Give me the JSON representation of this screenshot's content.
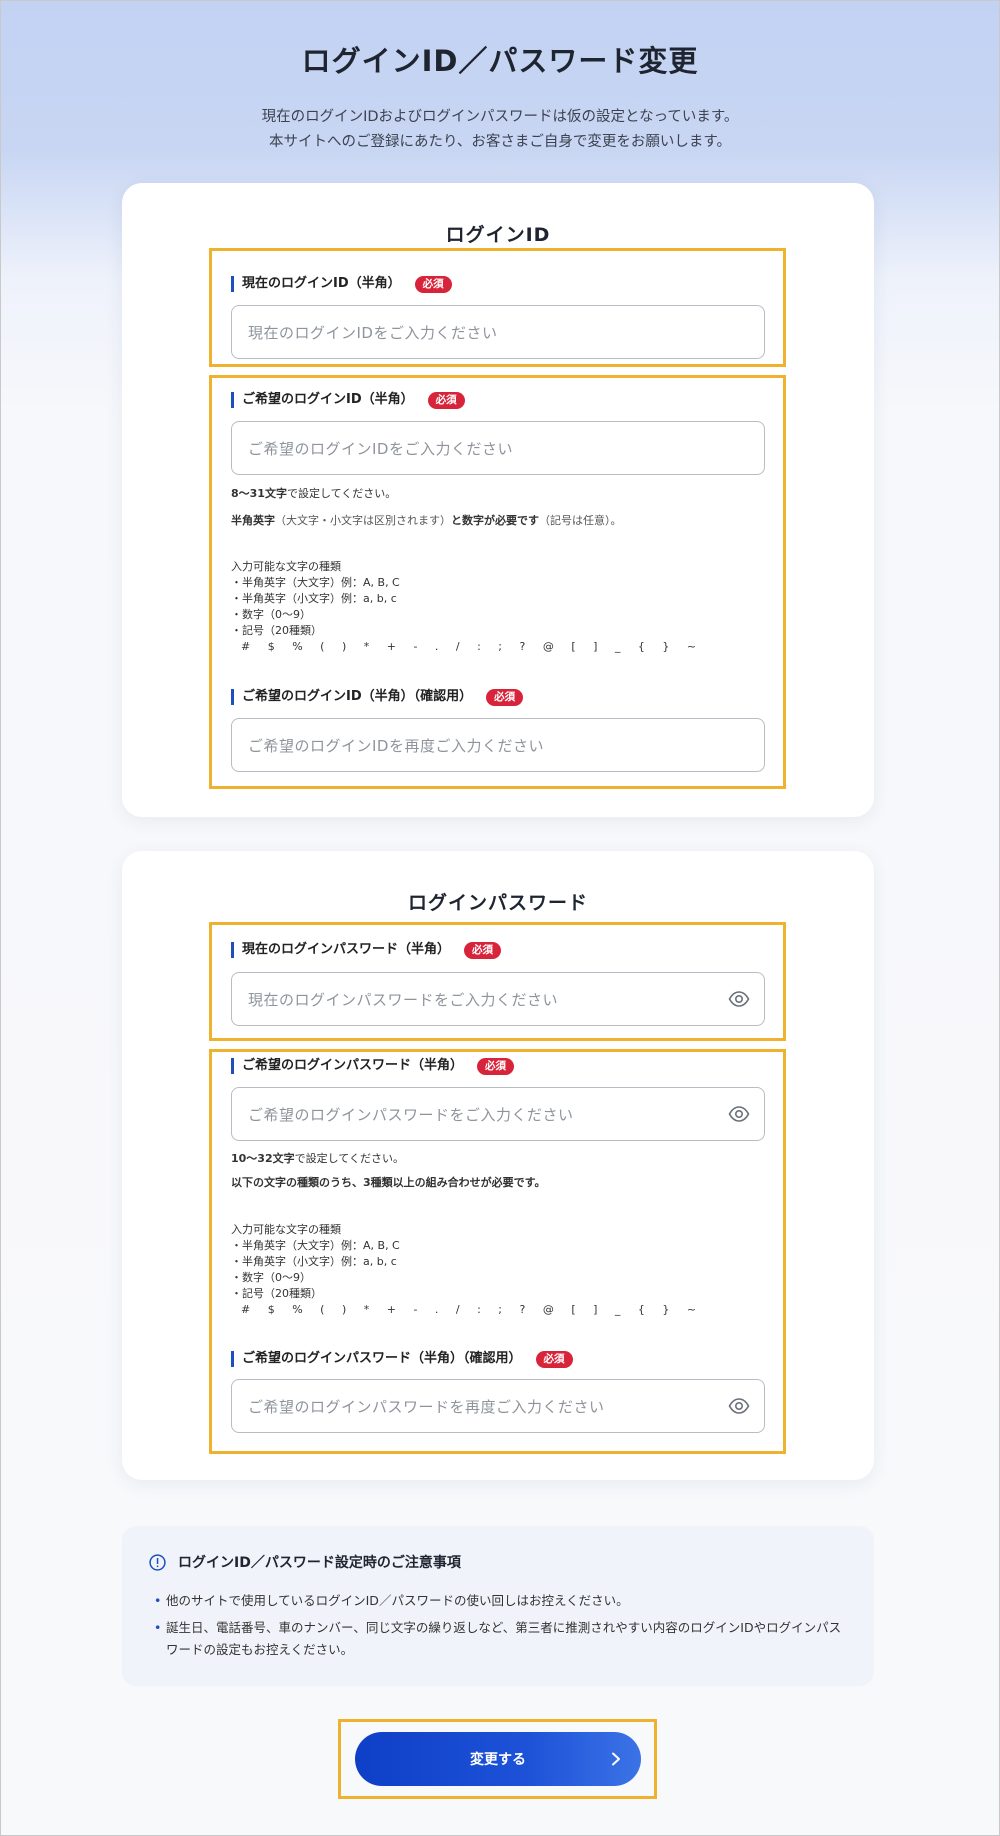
{
  "page": {
    "title": "ログインID／パスワード変更",
    "lead_line1": "現在のログインIDおよびログインパスワードは仮の設定となっています。",
    "lead_line2": "本サイトへのご登録にあたり、お客さまご自身で変更をお願いします。"
  },
  "required_label": "必須",
  "login_id": {
    "title": "ログインID",
    "current": {
      "label": "現在のログインID（半角）",
      "placeholder": "現在のログインIDをご入力ください"
    },
    "new": {
      "label": "ご希望のログインID（半角）",
      "placeholder": "ご希望のログインIDをご入力ください",
      "rule_length_bold": "8〜31文字",
      "rule_length_rest": "で設定してください。",
      "rule_mix_a": "半角英字",
      "rule_mix_b": "（大文字・小文字は区別されます）",
      "rule_mix_c": "と数字が必要です",
      "rule_mix_d": "（記号は任意）。",
      "chars_heading": "入力可能な文字の種類",
      "chars": [
        "・半角英字（大文字）例：A, B, C",
        "・半角英字（小文字）例：a, b, c",
        "・数字（0〜9）",
        "・記号（20種類）"
      ],
      "symbols": "# $ % ( ) * + - . / : ; ? @ [ ] _ { } ~"
    },
    "confirm": {
      "label": "ご希望のログインID（半角）（確認用）",
      "placeholder": "ご希望のログインIDを再度ご入力ください"
    }
  },
  "password": {
    "title": "ログインパスワード",
    "current": {
      "label": "現在のログインパスワード（半角）",
      "placeholder": "現在のログインパスワードをご入力ください"
    },
    "new": {
      "label": "ご希望のログインパスワード（半角）",
      "placeholder": "ご希望のログインパスワードをご入力ください",
      "rule_length_bold": "10〜32文字",
      "rule_length_rest": "で設定してください。",
      "rule_mix": "以下の文字の種類のうち、3種類以上の組み合わせが必要です。",
      "chars_heading": "入力可能な文字の種類",
      "chars": [
        "・半角英字（大文字）例：A, B, C",
        "・半角英字（小文字）例：a, b, c",
        "・数字（0〜9）",
        "・記号（20種類）"
      ],
      "symbols": "# $ % ( ) * + - . / : ; ? @ [ ] _ { } ~"
    },
    "confirm": {
      "label": "ご希望のログインパスワード（半角）（確認用）",
      "placeholder": "ご希望のログインパスワードを再度ご入力ください"
    }
  },
  "caution": {
    "title": "ログインID／パスワード設定時のご注意事項",
    "items": [
      "他のサイトで使用しているログインID／パスワードの使い回しはお控えください。",
      "誕生日、電話番号、車のナンバー、同じ文字の繰り返しなど、第三者に推測されやすい内容のログインIDやログインパスワードの設定もお控えください。"
    ]
  },
  "submit_label": "変更する",
  "icons": {
    "password_toggle": "eye-icon",
    "caution": "info-icon",
    "submit_arrow": "chevron-right-icon"
  },
  "colors": {
    "accent": "#1d4fc1",
    "required_badge": "#d8243b",
    "highlight": "#efb22f",
    "button": "#1d52d8"
  }
}
